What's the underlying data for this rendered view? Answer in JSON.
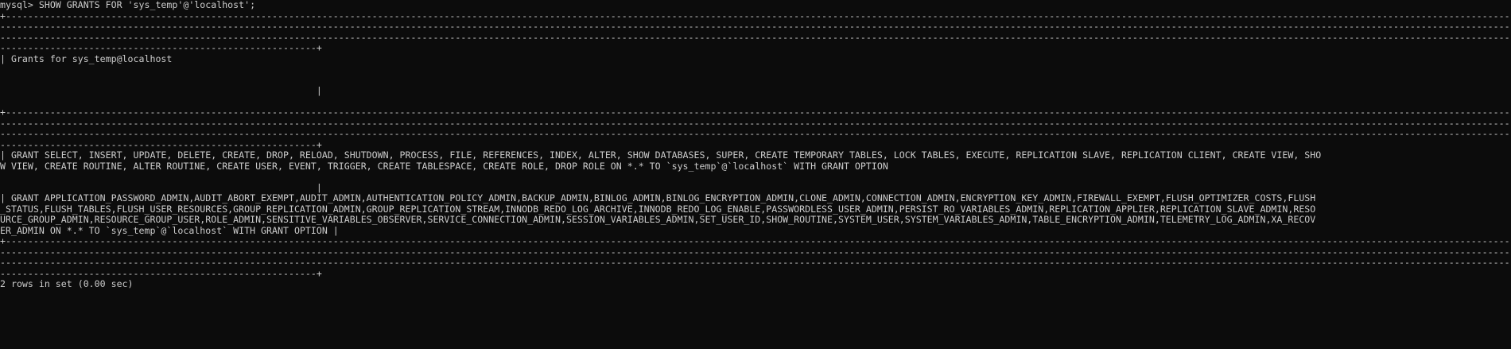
{
  "terminal": {
    "lines": [
      "mysql> SHOW GRANTS FOR 'sys_temp'@'localhost';",
      "+--------------------------------------------------------------------------------------------------------------------------------------------------------------------------------------------------------------------------------------------------------------------------------------------------",
      "----------------------------------------------------------------------------------------------------------------------------------------------------------------------------------------------------------------------------------------------------------------------------------------------------",
      "----------------------------------------------------------------------------------------------------------------------------------------------------------------------------------------------------------------------------------------------------------------------------------------------------",
      "---------------------------------------------------------+",
      "| Grants for sys_temp@localhost",
      "",
      "",
      "                                                         |",
      "",
      "+--------------------------------------------------------------------------------------------------------------------------------------------------------------------------------------------------------------------------------------------------------------------------------------------------",
      "----------------------------------------------------------------------------------------------------------------------------------------------------------------------------------------------------------------------------------------------------------------------------------------------------",
      "----------------------------------------------------------------------------------------------------------------------------------------------------------------------------------------------------------------------------------------------------------------------------------------------------",
      "---------------------------------------------------------+",
      "| GRANT SELECT, INSERT, UPDATE, DELETE, CREATE, DROP, RELOAD, SHUTDOWN, PROCESS, FILE, REFERENCES, INDEX, ALTER, SHOW DATABASES, SUPER, CREATE TEMPORARY TABLES, LOCK TABLES, EXECUTE, REPLICATION SLAVE, REPLICATION CLIENT, CREATE VIEW, SHO",
      "W VIEW, CREATE ROUTINE, ALTER ROUTINE, CREATE USER, EVENT, TRIGGER, CREATE TABLESPACE, CREATE ROLE, DROP ROLE ON *.* TO `sys_temp`@`localhost` WITH GRANT OPTION",
      "",
      "                                                         |",
      "| GRANT APPLICATION_PASSWORD_ADMIN,AUDIT_ABORT_EXEMPT,AUDIT_ADMIN,AUTHENTICATION_POLICY_ADMIN,BACKUP_ADMIN,BINLOG_ADMIN,BINLOG_ENCRYPTION_ADMIN,CLONE_ADMIN,CONNECTION_ADMIN,ENCRYPTION_KEY_ADMIN,FIREWALL_EXEMPT,FLUSH_OPTIMIZER_COSTS,FLUSH",
      "_STATUS,FLUSH_TABLES,FLUSH_USER_RESOURCES,GROUP_REPLICATION_ADMIN,GROUP_REPLICATION_STREAM,INNODB_REDO_LOG_ARCHIVE,INNODB_REDO_LOG_ENABLE,PASSWORDLESS_USER_ADMIN,PERSIST_RO_VARIABLES_ADMIN,REPLICATION_APPLIER,REPLICATION_SLAVE_ADMIN,RESO",
      "URCE_GROUP_ADMIN,RESOURCE_GROUP_USER,ROLE_ADMIN,SENSITIVE_VARIABLES_OBSERVER,SERVICE_CONNECTION_ADMIN,SESSION_VARIABLES_ADMIN,SET_USER_ID,SHOW_ROUTINE,SYSTEM_USER,SYSTEM_VARIABLES_ADMIN,TABLE_ENCRYPTION_ADMIN,TELEMETRY_LOG_ADMIN,XA_RECOV",
      "ER_ADMIN ON *.* TO `sys_temp`@`localhost` WITH GRANT OPTION |",
      "+--------------------------------------------------------------------------------------------------------------------------------------------------------------------------------------------------------------------------------------------------------------------------------------------------",
      "----------------------------------------------------------------------------------------------------------------------------------------------------------------------------------------------------------------------------------------------------------------------------------------------------",
      "----------------------------------------------------------------------------------------------------------------------------------------------------------------------------------------------------------------------------------------------------------------------------------------------------",
      "---------------------------------------------------------+",
      "2 rows in set (0.00 sec)",
      ""
    ]
  },
  "colors": {
    "background": "#0c0c0c",
    "text": "#cccccc"
  }
}
